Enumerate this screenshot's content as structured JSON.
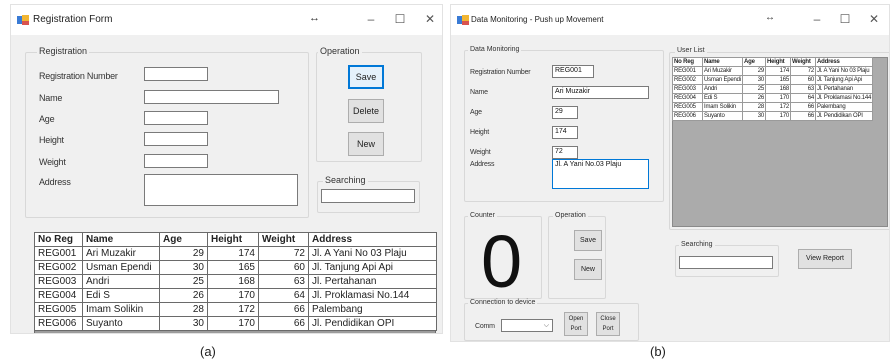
{
  "form_a": {
    "title": "Registration Form",
    "controls": {
      "resize": "↔",
      "minimize": "–",
      "maximize": "☐",
      "close": "✕"
    },
    "registration_group": "Registration",
    "labels": {
      "reg_number": "Registration Number",
      "name": "Name",
      "age": "Age",
      "height": "Height",
      "weight": "Weight",
      "address": "Address"
    },
    "operation_group": "Operation",
    "buttons": {
      "save": "Save",
      "delete": "Delete",
      "new": "New"
    },
    "searching_group": "Searching",
    "table": {
      "headers": [
        "No Reg",
        "Name",
        "Age",
        "Height",
        "Weight",
        "Address"
      ],
      "rows": [
        [
          "REG001",
          "Ari Muzakir",
          "29",
          "174",
          "72",
          "Jl. A Yani No 03 Plaju"
        ],
        [
          "REG002",
          "Usman Ependi",
          "30",
          "165",
          "60",
          "Jl. Tanjung Api Api"
        ],
        [
          "REG003",
          "Andri",
          "25",
          "168",
          "63",
          "Jl. Pertahanan"
        ],
        [
          "REG004",
          "Edi S",
          "26",
          "170",
          "64",
          "Jl. Proklamasi No.144"
        ],
        [
          "REG005",
          "Imam Solikin",
          "28",
          "172",
          "66",
          "Palembang"
        ],
        [
          "REG006",
          "Suyanto",
          "30",
          "170",
          "66",
          "Jl. Pendidikan OPI"
        ]
      ]
    }
  },
  "form_b": {
    "title": "Data Monitoring - Push up Movement",
    "controls": {
      "resize": "↔",
      "minimize": "–",
      "maximize": "☐",
      "close": "✕"
    },
    "monitoring_group": "Data Monitoring",
    "labels": {
      "reg_number": "Registration Number",
      "name": "Name",
      "age": "Age",
      "height": "Height",
      "weight": "Weight",
      "address": "Address"
    },
    "values": {
      "reg_number": "REG001",
      "name": "Ari Muzakir",
      "age": "29",
      "height": "174",
      "weight": "72",
      "address": "Jl. A Yani No.03 Plaju"
    },
    "userlist_group": "User List",
    "table": {
      "headers": [
        "No Reg",
        "Name",
        "Age",
        "Height",
        "Weight",
        "Address"
      ],
      "rows": [
        [
          "REG001",
          "Ari Muzakir",
          "29",
          "174",
          "72",
          "Jl. A Yani No 03 Plaju"
        ],
        [
          "REG002",
          "Usman Ependi",
          "30",
          "165",
          "60",
          "Jl. Tanjung Api Api"
        ],
        [
          "REG003",
          "Andri",
          "25",
          "168",
          "63",
          "Jl. Pertahanan"
        ],
        [
          "REG004",
          "Edi S",
          "26",
          "170",
          "64",
          "Jl. Proklamasi No.144"
        ],
        [
          "REG005",
          "Imam Solikin",
          "28",
          "172",
          "66",
          "Palembang"
        ],
        [
          "REG006",
          "Suyanto",
          "30",
          "170",
          "66",
          "Jl. Pendidikan OPI"
        ]
      ]
    },
    "counter_group": "Counter",
    "counter_value": "0",
    "operation_group": "Operation",
    "buttons": {
      "save": "Save",
      "new": "New",
      "view_report": "View Report",
      "open_port": "Open Port",
      "close_port": "Close Port"
    },
    "searching_group": "Searching",
    "connection_group": "Connection to device",
    "comm_label": "Comm"
  },
  "captions": {
    "a": "(a)",
    "b": "(b)"
  }
}
